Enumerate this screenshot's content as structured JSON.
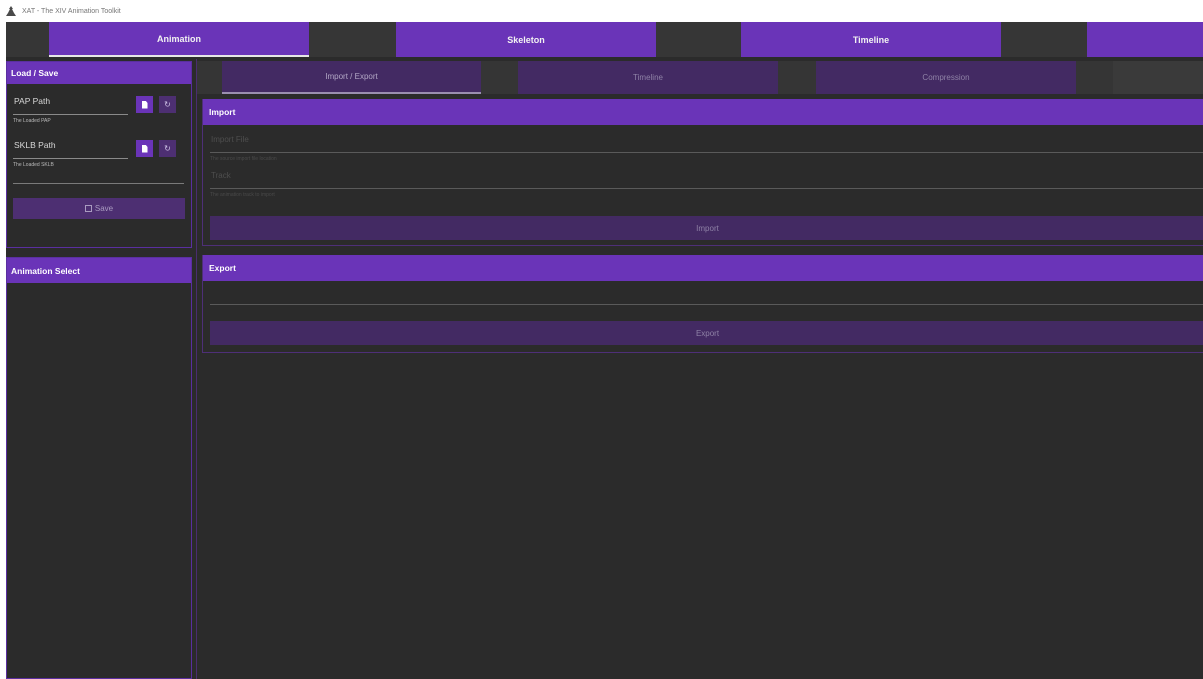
{
  "window": {
    "title": "XAT - The XIV Animation Toolkit"
  },
  "top_tabs": [
    {
      "label": "Animation",
      "active": true
    },
    {
      "label": "Skeleton",
      "active": false
    },
    {
      "label": "Timeline",
      "active": false
    },
    {
      "label": "",
      "active": false
    }
  ],
  "load_save": {
    "header": "Load / Save",
    "pap": {
      "label": "PAP Path",
      "help": "The Loaded PAP"
    },
    "sklb": {
      "label": "SKLB Path",
      "help": "The Loaded SKLB"
    },
    "save_label": "Save"
  },
  "animation_select": {
    "header": "Animation Select"
  },
  "sub_tabs": [
    {
      "label": "Import / Export",
      "active": true
    },
    {
      "label": "Timeline",
      "active": false
    },
    {
      "label": "Compression",
      "active": false
    }
  ],
  "import_section": {
    "header": "Import",
    "file_field": {
      "label": "Import File",
      "help": "The source import file location"
    },
    "track_field": {
      "label": "Track",
      "help": "The animation track to import"
    },
    "button": "Import"
  },
  "export_section": {
    "header": "Export",
    "button": "Export"
  },
  "colors": {
    "accent": "#6a34b8",
    "background": "#2b2b2b",
    "muted_button": "#432a63"
  }
}
